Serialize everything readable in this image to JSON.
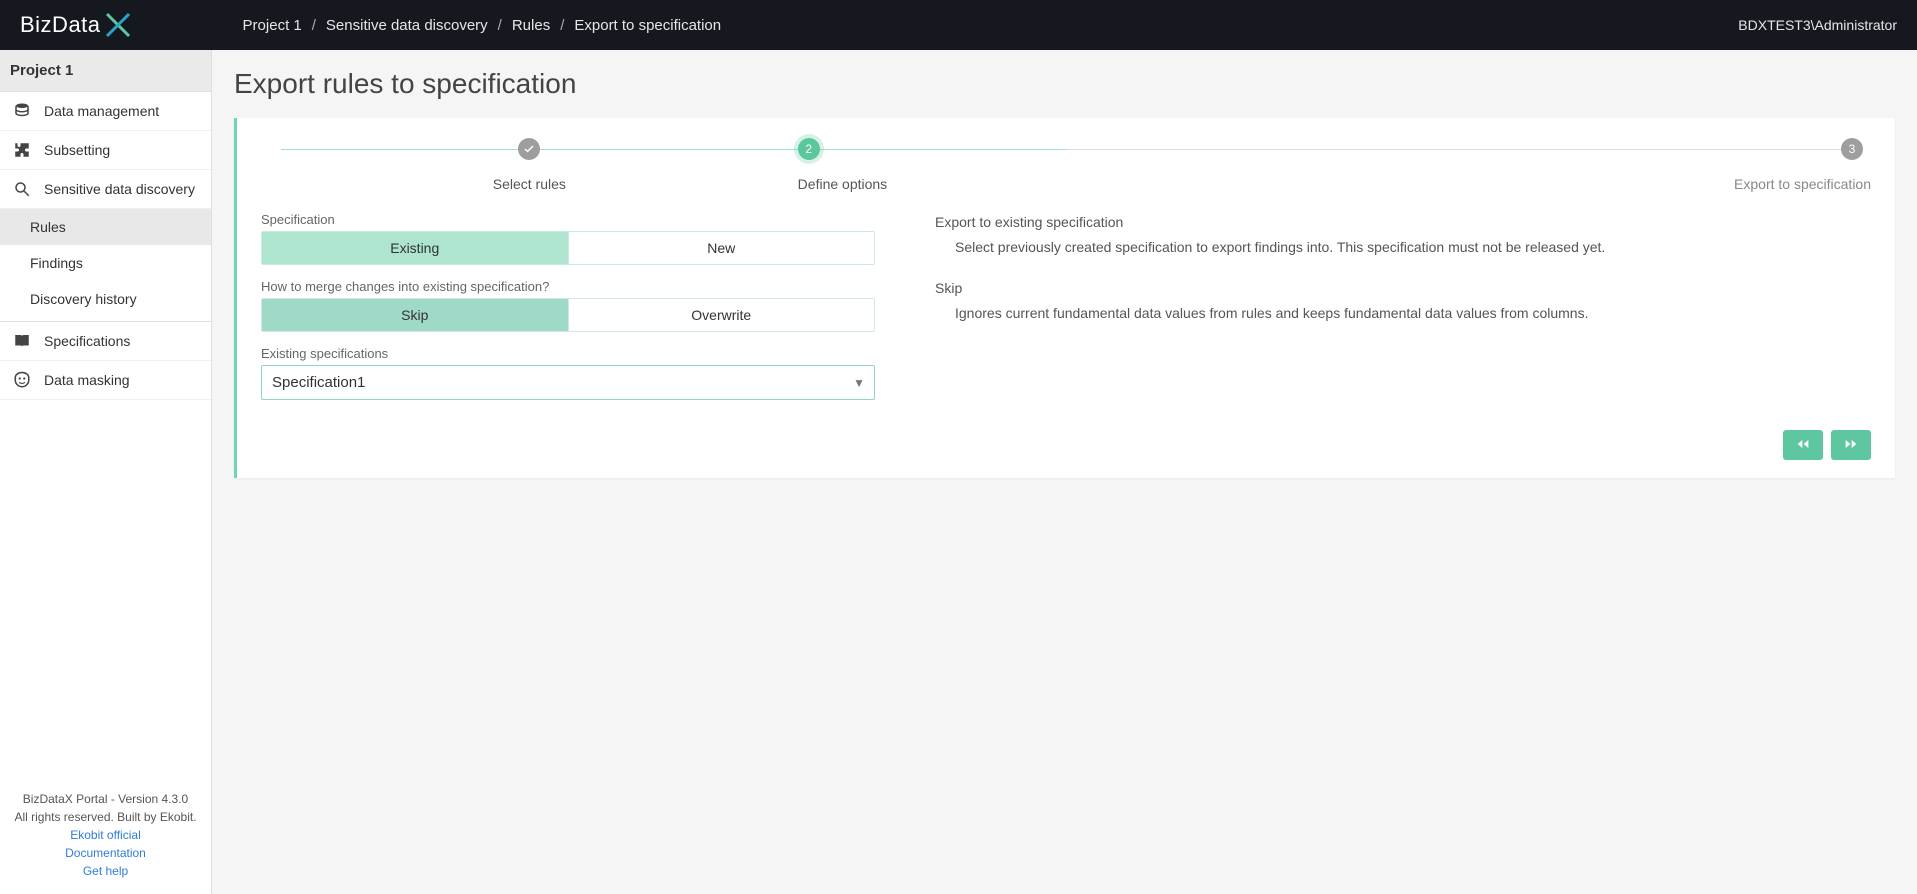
{
  "brand": {
    "part1": "BizData"
  },
  "header": {
    "breadcrumb": [
      "Project 1",
      "Sensitive data discovery",
      "Rules",
      "Export to specification"
    ],
    "user": "BDXTEST3\\Administrator"
  },
  "sidebar": {
    "project": "Project 1",
    "items": [
      {
        "label": "Data management"
      },
      {
        "label": "Subsetting"
      },
      {
        "label": "Sensitive data discovery"
      },
      {
        "label": "Specifications"
      },
      {
        "label": "Data masking"
      }
    ],
    "discoverySub": [
      {
        "label": "Rules",
        "active": true
      },
      {
        "label": "Findings"
      },
      {
        "label": "Discovery history"
      }
    ],
    "footer": {
      "line1": "BizDataX Portal - Version 4.3.0",
      "line2": "All rights reserved. Built by Ekobit.",
      "links": [
        "Ekobit official",
        "Documentation",
        "Get help"
      ]
    }
  },
  "page": {
    "title": "Export rules to specification",
    "steps": [
      {
        "label": "Select rules",
        "state": "done"
      },
      {
        "label": "Define options",
        "state": "current",
        "num": "2"
      },
      {
        "label": "Export to specification",
        "state": "future",
        "num": "3"
      }
    ],
    "form": {
      "spec_label": "Specification",
      "spec_options": [
        "Existing",
        "New"
      ],
      "spec_selected": 0,
      "merge_label": "How to merge changes into existing specification?",
      "merge_options": [
        "Skip",
        "Overwrite"
      ],
      "merge_selected": 0,
      "existing_label": "Existing specifications",
      "existing_value": "Specification1"
    },
    "help": {
      "h1": "Export to existing specification",
      "p1": "Select previously created specification to export findings into. This specification must not be released yet.",
      "h2": "Skip",
      "p2": "Ignores current fundamental data values from rules and keeps fundamental data values from columns."
    }
  }
}
